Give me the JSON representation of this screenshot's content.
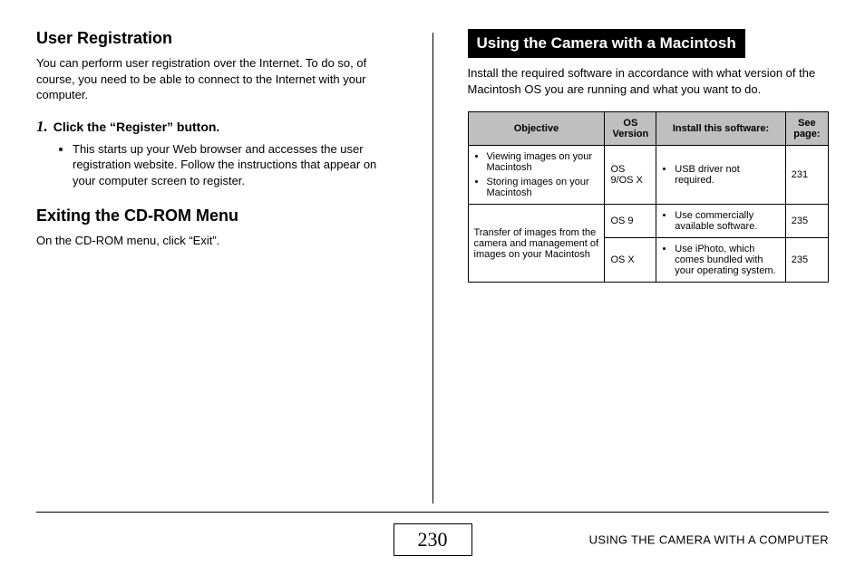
{
  "left": {
    "heading1": "User Registration",
    "para1": "You can perform user registration over the Internet. To do so, of course, you need to be able to connect to the Internet with your computer.",
    "step_num": "1.",
    "step_text": "Click the “Register” button.",
    "step_bullet": "This starts up your Web browser and accesses the user registration website. Follow the instructions that appear on your computer screen to register.",
    "heading2": "Exiting the CD-ROM Menu",
    "para2": "On the CD-ROM menu, click “Exit”."
  },
  "right": {
    "banner": "Using the Camera with a Macintosh",
    "intro": "Install the required software in accordance with what version of the Macintosh OS you are running and what you want to do.",
    "table": {
      "headers": {
        "objective": "Objective",
        "os": "OS Version",
        "install": "Install this software:",
        "see": "See page:"
      },
      "row1": {
        "obj_a": "Viewing images on your Macintosh",
        "obj_b": "Storing images on your Macintosh",
        "os": "OS 9/OS X",
        "install": "USB driver not required.",
        "page": "231"
      },
      "row2": {
        "objective": "Transfer of images from the camera and management of images on your Macintosh",
        "os_a": "OS 9",
        "install_a": "Use commercially available software.",
        "page_a": "235",
        "os_b": "OS X",
        "install_b": "Use iPhoto, which comes bundled with your operating system.",
        "page_b": "235"
      }
    }
  },
  "footer": {
    "page": "230",
    "text": "USING THE CAMERA WITH A COMPUTER"
  }
}
